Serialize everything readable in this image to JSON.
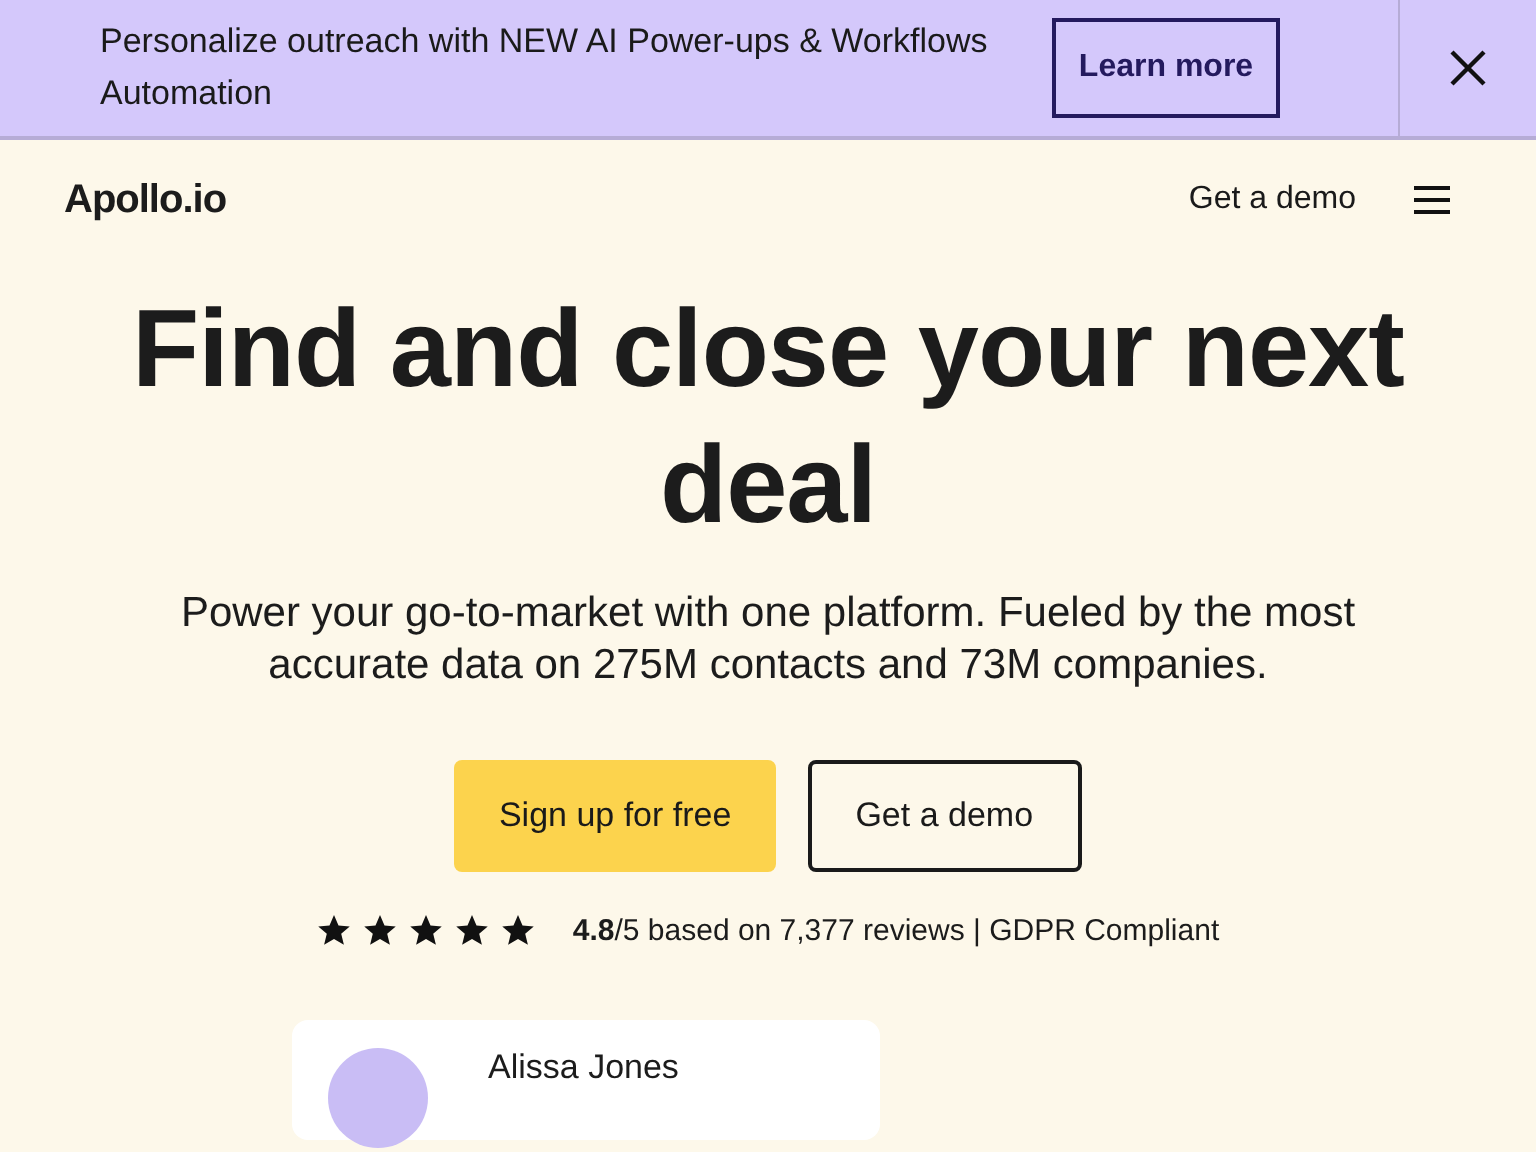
{
  "banner": {
    "message": "Personalize outreach with NEW AI Power-ups & Workflows Automation",
    "button": "Learn more"
  },
  "nav": {
    "logo": "Apollo.io",
    "link": "Get a demo"
  },
  "hero": {
    "title": "Find and close your next deal",
    "subtitle": "Power your go-to-market with one platform. Fueled by the most accurate data on 275M contacts and 73M companies.",
    "buttons": [
      {
        "label": "Sign up for free",
        "kind": "primary"
      },
      {
        "label": "Get a demo",
        "kind": "secondary"
      }
    ],
    "rating": {
      "stars": 5,
      "text": "**4.8**/5 based on 7,377 reviews | GDPR Compliant"
    }
  },
  "testimonial": {
    "name": "Alissa Jones"
  }
}
